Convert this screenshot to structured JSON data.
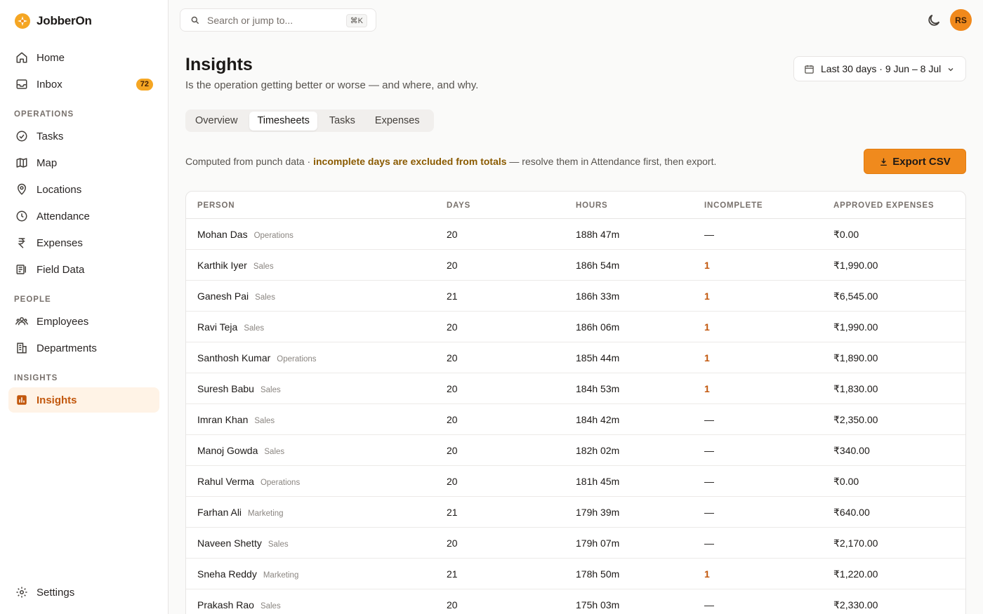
{
  "app": {
    "name": "JobberOn"
  },
  "sidebar": {
    "top_items": [
      {
        "label": "Home",
        "icon": "home-icon"
      },
      {
        "label": "Inbox",
        "icon": "inbox-icon",
        "badge": "72"
      }
    ],
    "sections": [
      {
        "label": "OPERATIONS",
        "items": [
          {
            "label": "Tasks",
            "icon": "check-circle-icon"
          },
          {
            "label": "Map",
            "icon": "map-icon"
          },
          {
            "label": "Locations",
            "icon": "pin-icon"
          },
          {
            "label": "Attendance",
            "icon": "clock-icon"
          },
          {
            "label": "Expenses",
            "icon": "rupee-icon"
          },
          {
            "label": "Field Data",
            "icon": "form-icon"
          }
        ]
      },
      {
        "label": "PEOPLE",
        "items": [
          {
            "label": "Employees",
            "icon": "users-icon"
          },
          {
            "label": "Departments",
            "icon": "building-icon"
          }
        ]
      },
      {
        "label": "INSIGHTS",
        "items": [
          {
            "label": "Insights",
            "icon": "bar-chart-icon",
            "active": true
          }
        ]
      }
    ],
    "settings": {
      "label": "Settings",
      "icon": "gear-icon"
    }
  },
  "search": {
    "placeholder": "Search or jump to...",
    "shortcut": "⌘K"
  },
  "user": {
    "initials": "RS"
  },
  "colors": {
    "accent": "#f08a1d",
    "active_bg": "#fff3e6",
    "incomplete": "#c2570c"
  },
  "header": {
    "title": "Insights",
    "subtitle": "Is the operation getting better or worse — and where, and why.",
    "date_range": "Last 30 days · 9 Jun – 8 Jul"
  },
  "tabs": [
    {
      "label": "Overview"
    },
    {
      "label": "Timesheets",
      "active": true
    },
    {
      "label": "Tasks"
    },
    {
      "label": "Expenses"
    }
  ],
  "notice": {
    "prefix": "Computed from punch data · ",
    "highlight": "incomplete days are excluded from totals",
    "suffix": " — resolve them in Attendance first, then export."
  },
  "export_label": "Export CSV",
  "table": {
    "columns": [
      "PERSON",
      "DAYS",
      "HOURS",
      "INCOMPLETE",
      "APPROVED EXPENSES"
    ],
    "rows": [
      {
        "name": "Mohan Das",
        "dept": "Operations",
        "days": "20",
        "hours": "188h 47m",
        "incomplete": "—",
        "expenses": "₹0.00"
      },
      {
        "name": "Karthik Iyer",
        "dept": "Sales",
        "days": "20",
        "hours": "186h 54m",
        "incomplete": "1",
        "expenses": "₹1,990.00"
      },
      {
        "name": "Ganesh Pai",
        "dept": "Sales",
        "days": "21",
        "hours": "186h 33m",
        "incomplete": "1",
        "expenses": "₹6,545.00"
      },
      {
        "name": "Ravi Teja",
        "dept": "Sales",
        "days": "20",
        "hours": "186h 06m",
        "incomplete": "1",
        "expenses": "₹1,990.00"
      },
      {
        "name": "Santhosh Kumar",
        "dept": "Operations",
        "days": "20",
        "hours": "185h 44m",
        "incomplete": "1",
        "expenses": "₹1,890.00"
      },
      {
        "name": "Suresh Babu",
        "dept": "Sales",
        "days": "20",
        "hours": "184h 53m",
        "incomplete": "1",
        "expenses": "₹1,830.00"
      },
      {
        "name": "Imran Khan",
        "dept": "Sales",
        "days": "20",
        "hours": "184h 42m",
        "incomplete": "—",
        "expenses": "₹2,350.00"
      },
      {
        "name": "Manoj Gowda",
        "dept": "Sales",
        "days": "20",
        "hours": "182h 02m",
        "incomplete": "—",
        "expenses": "₹340.00"
      },
      {
        "name": "Rahul Verma",
        "dept": "Operations",
        "days": "20",
        "hours": "181h 45m",
        "incomplete": "—",
        "expenses": "₹0.00"
      },
      {
        "name": "Farhan Ali",
        "dept": "Marketing",
        "days": "21",
        "hours": "179h 39m",
        "incomplete": "—",
        "expenses": "₹640.00"
      },
      {
        "name": "Naveen Shetty",
        "dept": "Sales",
        "days": "20",
        "hours": "179h 07m",
        "incomplete": "—",
        "expenses": "₹2,170.00"
      },
      {
        "name": "Sneha Reddy",
        "dept": "Marketing",
        "days": "21",
        "hours": "178h 50m",
        "incomplete": "1",
        "expenses": "₹1,220.00"
      },
      {
        "name": "Prakash Rao",
        "dept": "Sales",
        "days": "20",
        "hours": "175h 03m",
        "incomplete": "—",
        "expenses": "₹2,330.00"
      }
    ]
  }
}
